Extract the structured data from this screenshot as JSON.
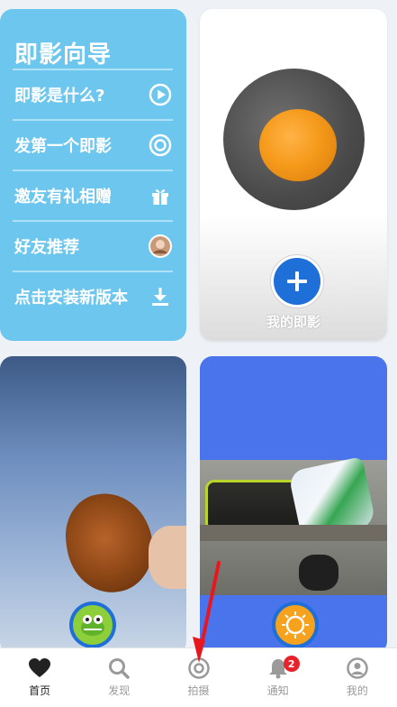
{
  "guide": {
    "title": "即影向导",
    "items": [
      {
        "label": "即影是什么?",
        "icon": "play-circle-icon"
      },
      {
        "label": "发第一个即影",
        "icon": "target-icon"
      },
      {
        "label": "邀友有礼相赠",
        "icon": "gift-icon"
      },
      {
        "label": "好友推荐",
        "icon": "friend-avatar-icon"
      },
      {
        "label": "点击安装新版本",
        "icon": "download-icon"
      }
    ]
  },
  "mine": {
    "label": "我的即影"
  },
  "tabs": [
    {
      "label": "首页",
      "icon": "heart-icon"
    },
    {
      "label": "发现",
      "icon": "search-icon"
    },
    {
      "label": "拍摄",
      "icon": "camera-target-icon"
    },
    {
      "label": "通知",
      "icon": "bell-icon",
      "badge": "2"
    },
    {
      "label": "我的",
      "icon": "profile-icon"
    }
  ],
  "colors": {
    "guide_bg": "#6cc6ee",
    "accent_blue": "#1f6fd9",
    "card_blue": "#4a74ec",
    "badge_red": "#e8222b",
    "arrow_red": "#e8171f"
  }
}
